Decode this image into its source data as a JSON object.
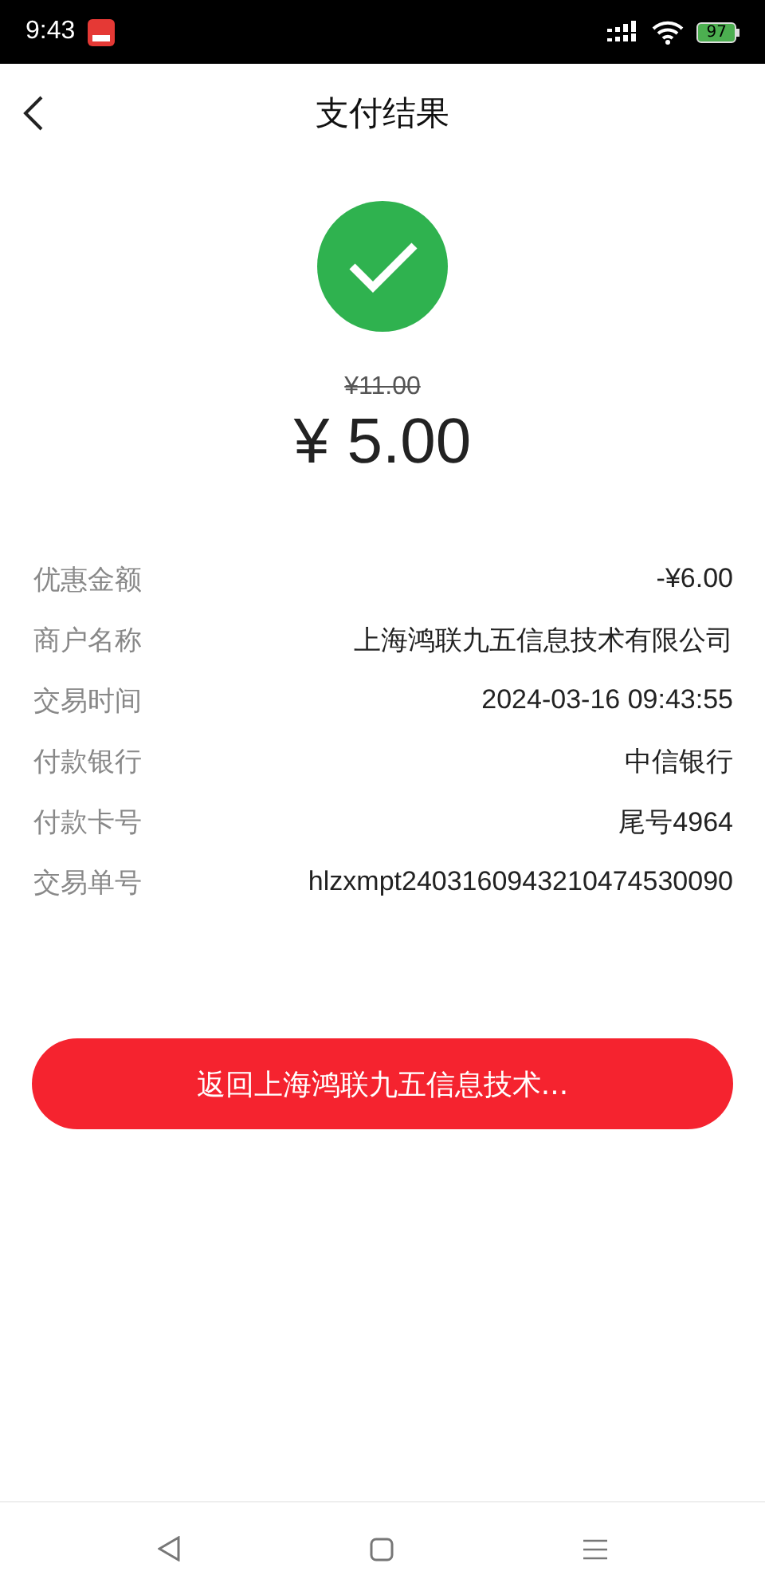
{
  "status_bar": {
    "time": "9:43",
    "battery": "97"
  },
  "header": {
    "title": "支付结果"
  },
  "result": {
    "original_price": "¥11.00",
    "amount": "¥ 5.00"
  },
  "details": [
    {
      "label": "优惠金额",
      "value": "-¥6.00"
    },
    {
      "label": "商户名称",
      "value": "上海鸿联九五信息技术有限公司"
    },
    {
      "label": "交易时间",
      "value": "2024-03-16 09:43:55"
    },
    {
      "label": "付款银行",
      "value": "中信银行"
    },
    {
      "label": "付款卡号",
      "value": "尾号4964"
    },
    {
      "label": "交易单号",
      "value": "hlzxmpt2403160943210474530090"
    }
  ],
  "return_button": {
    "label": "返回上海鸿联九五信息技术..."
  }
}
